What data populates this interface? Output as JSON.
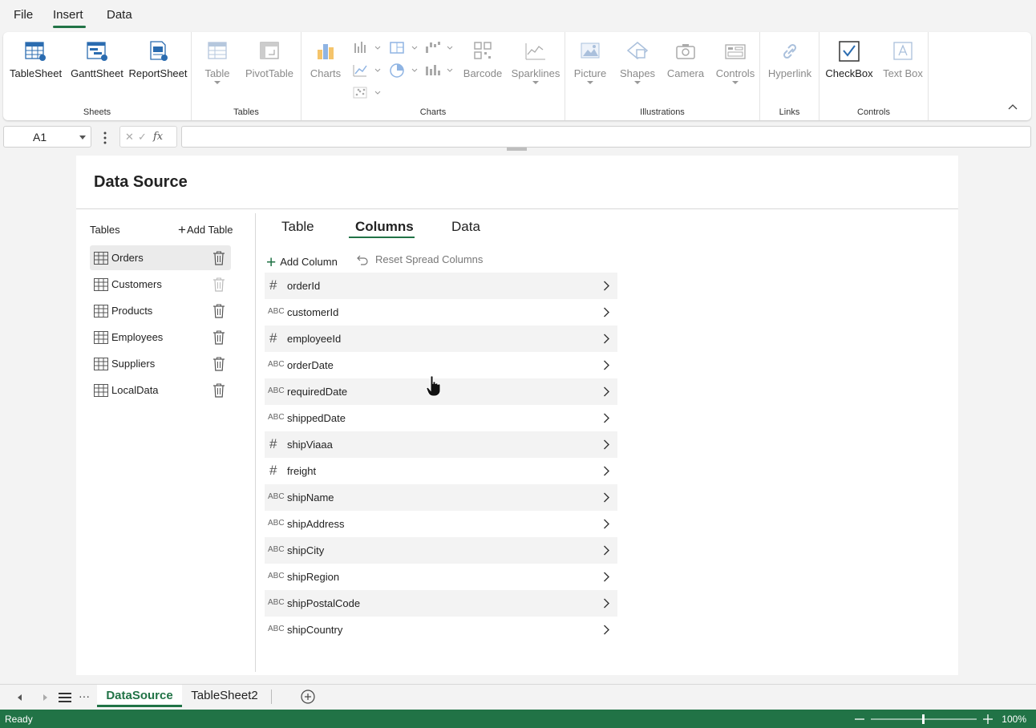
{
  "menu": {
    "items": [
      {
        "label": "File"
      },
      {
        "label": "Insert"
      },
      {
        "label": "Data"
      }
    ]
  },
  "ribbon": {
    "groups": {
      "sheets": {
        "label": "Sheets",
        "buttons": [
          "TableSheet",
          "GanttSheet",
          "ReportSheet"
        ]
      },
      "tables": {
        "label": "Tables",
        "buttons": [
          "Table",
          "PivotTable"
        ]
      },
      "charts": {
        "label": "Charts",
        "buttons": [
          "Charts",
          "Barcode",
          "Sparklines"
        ]
      },
      "illustrations": {
        "label": "Illustrations",
        "buttons": [
          "Picture",
          "Shapes",
          "Camera",
          "Controls"
        ]
      },
      "links": {
        "label": "Links",
        "buttons": [
          "Hyperlink"
        ]
      },
      "controls": {
        "label": "Controls",
        "buttons": [
          "CheckBox",
          "Text Box"
        ]
      }
    },
    "accent": "#217346"
  },
  "formula_bar": {
    "name_box": "A1",
    "cancel_glyph": "✕",
    "enter_glyph": "✓",
    "fx_label": "fx",
    "formula": ""
  },
  "data_source": {
    "title": "Data Source",
    "tables_label": "Tables",
    "add_table_label": "Add Table",
    "add_table_plus": "+",
    "tables": [
      {
        "name": "Orders"
      },
      {
        "name": "Customers"
      },
      {
        "name": "Products"
      },
      {
        "name": "Employees"
      },
      {
        "name": "Suppliers"
      },
      {
        "name": "LocalData"
      }
    ],
    "tabs": [
      {
        "label": "Table"
      },
      {
        "label": "Columns"
      },
      {
        "label": "Data"
      }
    ],
    "add_column_label": "Add Column",
    "add_column_plus": "+",
    "reset_columns_label": "Reset Spread Columns",
    "columns": [
      {
        "type": "#",
        "name": "orderId"
      },
      {
        "type": "ABC",
        "name": "customerId"
      },
      {
        "type": "#",
        "name": "employeeId"
      },
      {
        "type": "ABC",
        "name": "orderDate"
      },
      {
        "type": "ABC",
        "name": "requiredDate"
      },
      {
        "type": "ABC",
        "name": "shippedDate"
      },
      {
        "type": "#",
        "name": "shipViaaa"
      },
      {
        "type": "#",
        "name": "freight"
      },
      {
        "type": "ABC",
        "name": "shipName"
      },
      {
        "type": "ABC",
        "name": "shipAddress"
      },
      {
        "type": "ABC",
        "name": "shipCity"
      },
      {
        "type": "ABC",
        "name": "shipRegion"
      },
      {
        "type": "ABC",
        "name": "shipPostalCode"
      },
      {
        "type": "ABC",
        "name": "shipCountry"
      }
    ]
  },
  "sheet_tabs": {
    "tabs": [
      {
        "label": "DataSource"
      },
      {
        "label": "TableSheet2"
      }
    ],
    "more_glyph": "···"
  },
  "status": {
    "text": "Ready",
    "zoom": "100%"
  }
}
